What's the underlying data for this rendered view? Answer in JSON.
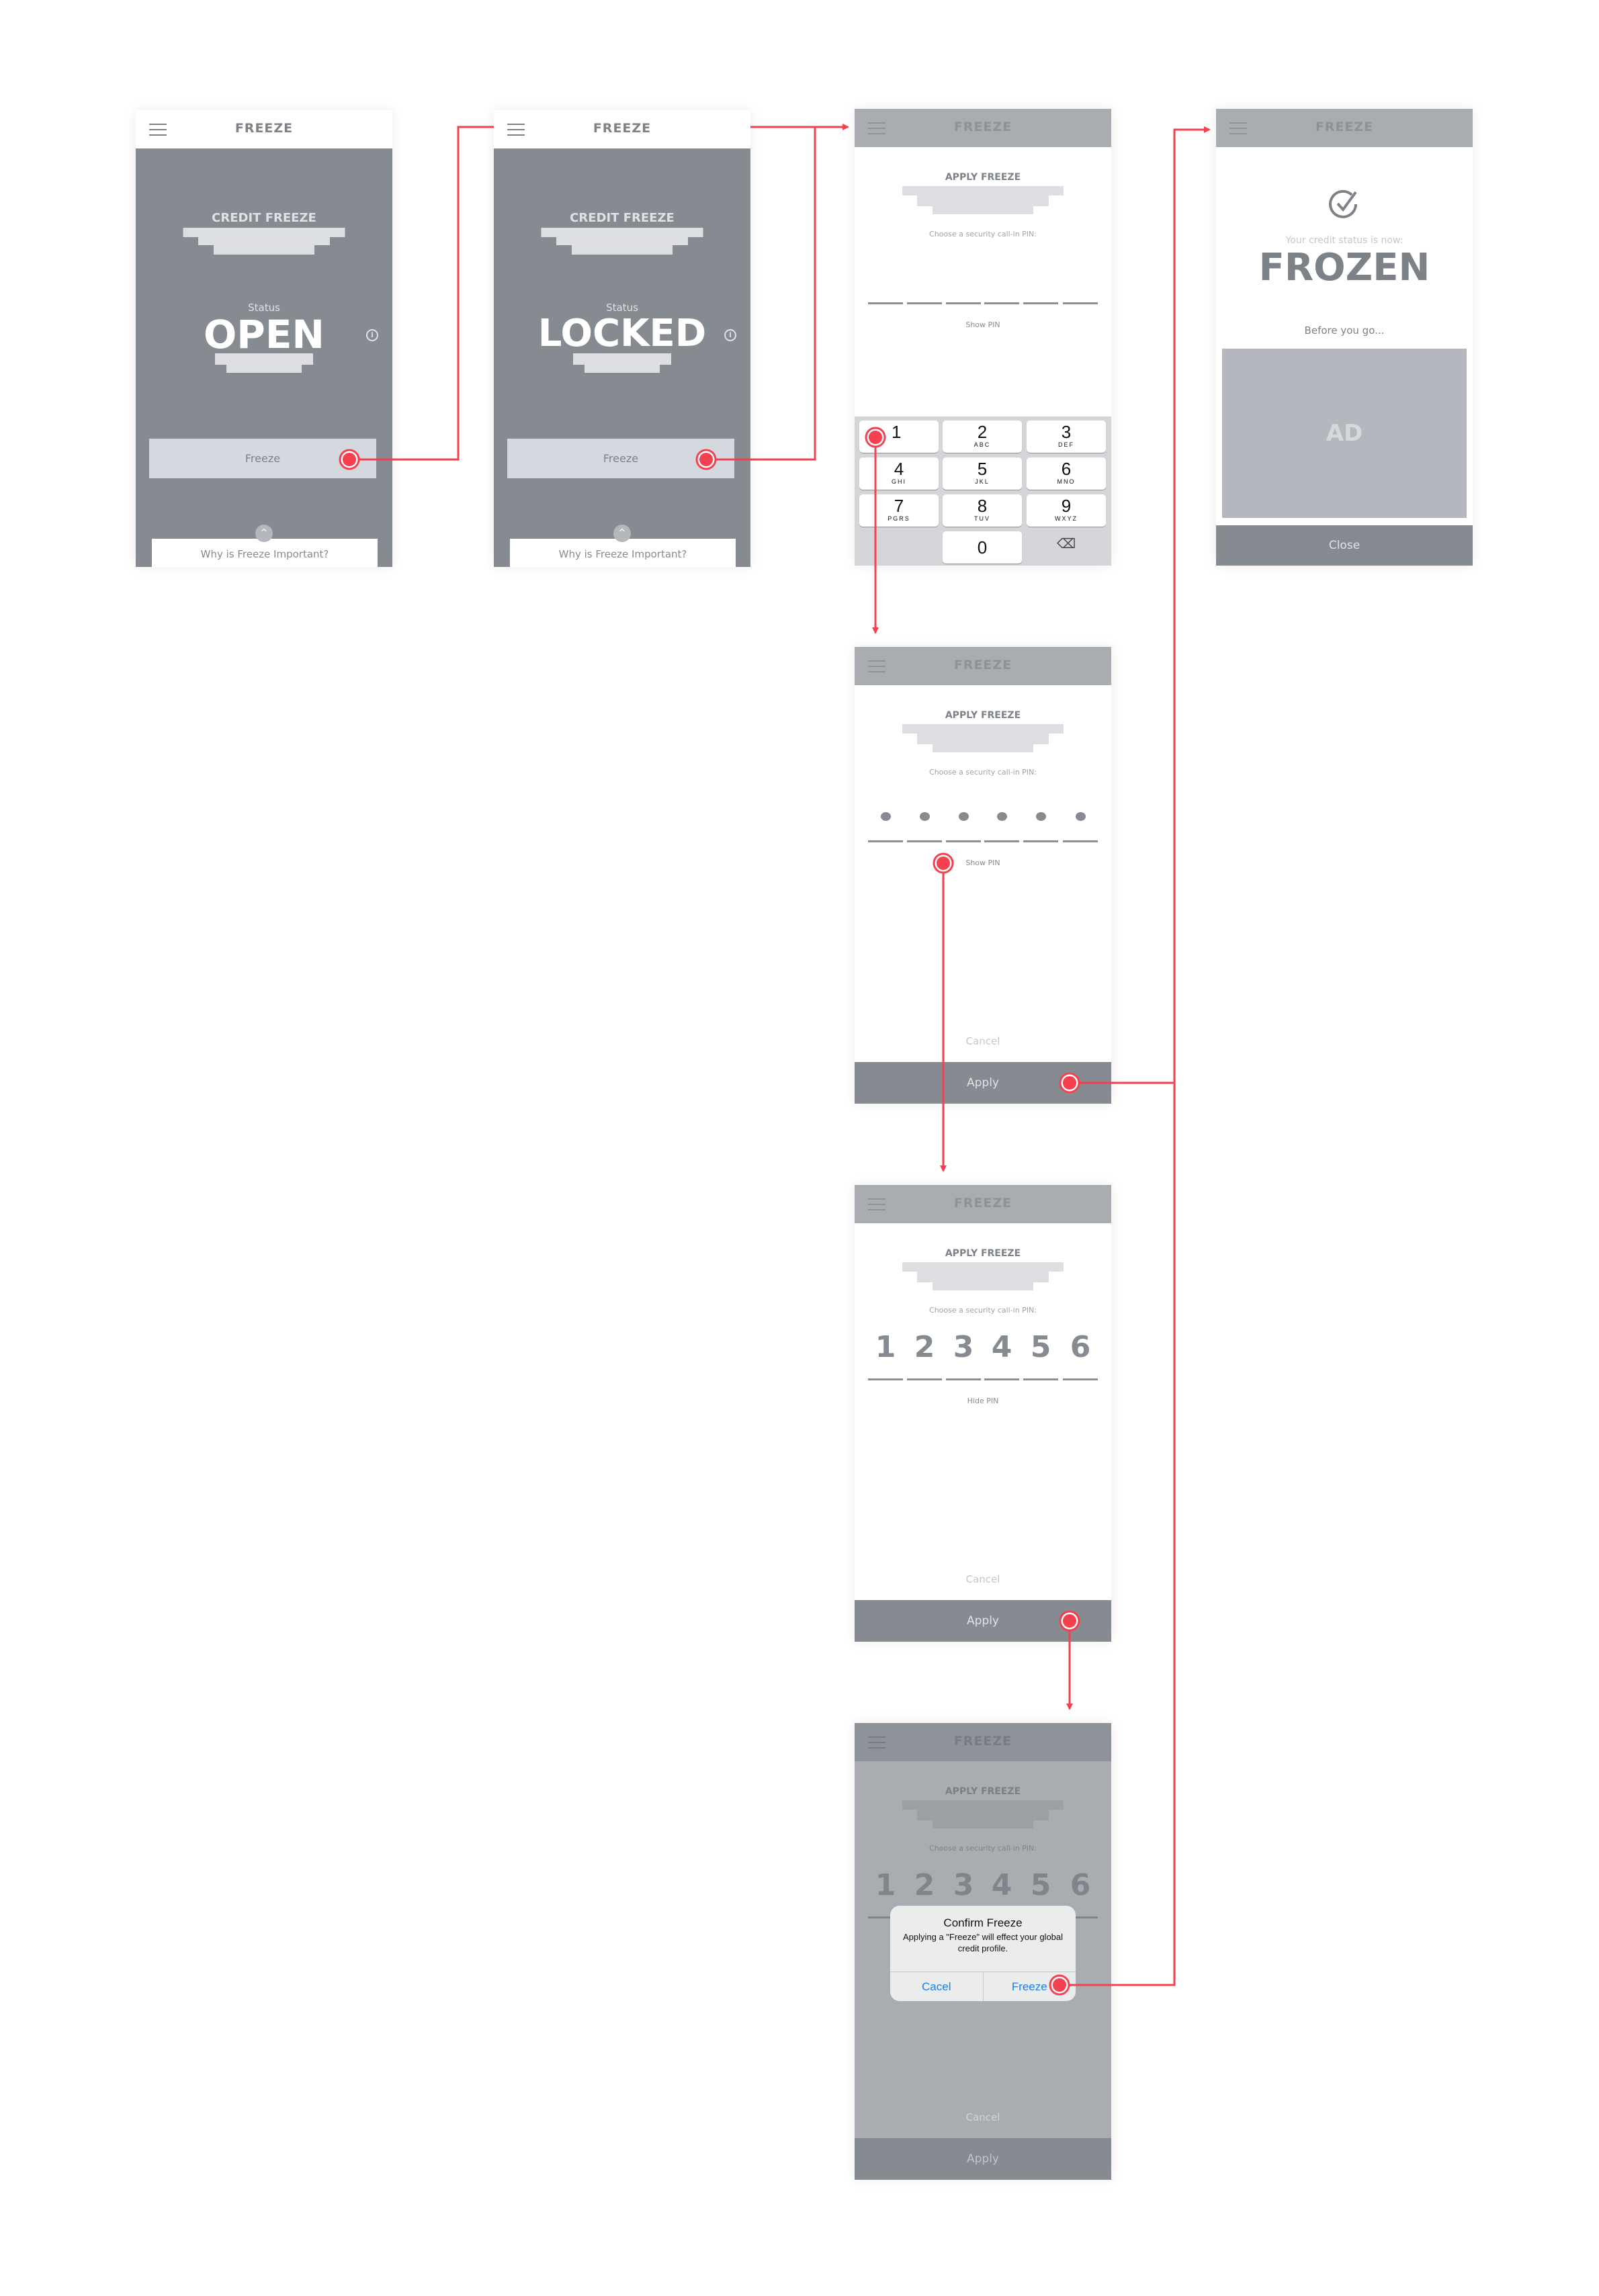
{
  "accent_color": "#f5414f",
  "screens": {
    "open": {
      "header_title": "FREEZE",
      "section_title": "CREDIT FREEZE",
      "status_label": "Status",
      "status_value": "OPEN",
      "freeze_button": "Freeze",
      "why_card": "Why is Freeze Important?",
      "icons": [
        "menu-icon",
        "info-icon",
        "chevron-up-icon"
      ]
    },
    "locked": {
      "header_title": "FREEZE",
      "section_title": "CREDIT FREEZE",
      "status_label": "Status",
      "status_value": "LOCKED",
      "freeze_button": "Freeze",
      "why_card": "Why is Freeze Important?"
    },
    "pin_entry": {
      "header_title": "FREEZE",
      "section_title": "APPLY FREEZE",
      "prompt": "Choose a security call-in PIN:",
      "toggle": "Show PIN",
      "keypad": [
        {
          "num": "1",
          "letters": ""
        },
        {
          "num": "2",
          "letters": "ABC"
        },
        {
          "num": "3",
          "letters": "DEF"
        },
        {
          "num": "4",
          "letters": "GHI"
        },
        {
          "num": "5",
          "letters": "JKL"
        },
        {
          "num": "6",
          "letters": "MNO"
        },
        {
          "num": "7",
          "letters": "PGRS"
        },
        {
          "num": "8",
          "letters": "TUV"
        },
        {
          "num": "9",
          "letters": "WXYZ"
        },
        {
          "num": "0",
          "letters": ""
        }
      ]
    },
    "frozen": {
      "header_title": "FREEZE",
      "status_label": "Your credit status is now:",
      "status_value": "FROZEN",
      "before_label": "Before you go...",
      "ad_label": "AD",
      "close_button": "Close"
    },
    "pin_hidden": {
      "header_title": "FREEZE",
      "section_title": "APPLY FREEZE",
      "prompt": "Choose a security call-in PIN:",
      "toggle": "Show PIN",
      "cancel": "Cancel",
      "apply": "Apply"
    },
    "pin_shown": {
      "header_title": "FREEZE",
      "section_title": "APPLY FREEZE",
      "prompt": "Choose a security call-in PIN:",
      "pin": [
        "1",
        "2",
        "3",
        "4",
        "5",
        "6"
      ],
      "toggle": "Hide PIN",
      "cancel": "Cancel",
      "apply": "Apply"
    },
    "confirm": {
      "header_title": "FREEZE",
      "section_title": "APPLY FREEZE",
      "prompt": "Choose a security call-in PIN:",
      "pin": [
        "1",
        "2",
        "3",
        "4",
        "5",
        "6"
      ],
      "cancel": "Cancel",
      "apply": "Apply",
      "dialog": {
        "title": "Confirm Freeze",
        "message": "Applying a \"Freeze\" will effect your global credit profile.",
        "cancel": "Cacel",
        "confirm": "Freeze"
      }
    }
  }
}
